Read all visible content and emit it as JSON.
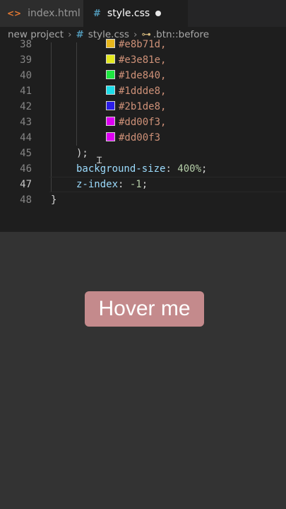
{
  "tabs": [
    {
      "label": "index.html",
      "icon": "html-file-icon",
      "active": false
    },
    {
      "label": "style.css",
      "icon": "css-file-icon",
      "active": true,
      "unsaved": true
    }
  ],
  "breadcrumb": {
    "folder": "new project",
    "file": "style.css",
    "symbol": ".btn::before"
  },
  "code": {
    "active_line": "47",
    "lines": [
      {
        "num": "38",
        "color": "#e8b71d",
        "text": "#e8b71d,"
      },
      {
        "num": "39",
        "color": "#e3e81e",
        "text": "#e3e81e,"
      },
      {
        "num": "40",
        "color": "#1de840",
        "text": "#1de840,"
      },
      {
        "num": "41",
        "color": "#1ddde8",
        "text": "#1ddde8,"
      },
      {
        "num": "42",
        "color": "#2b1de8",
        "text": "#2b1de8,"
      },
      {
        "num": "43",
        "color": "#dd00f3",
        "text": "#dd00f3,"
      },
      {
        "num": "44",
        "color": "#dd00f3",
        "text": "#dd00f3"
      },
      {
        "num": "45",
        "text": ");"
      },
      {
        "num": "46",
        "prop": "background-size",
        "value": "400%"
      },
      {
        "num": "47",
        "prop": "z-index",
        "value": "-1"
      },
      {
        "num": "48",
        "text": "}"
      }
    ]
  },
  "preview": {
    "button_label": "Hover me",
    "button_color": "#c48a8c",
    "background": "#333333"
  }
}
